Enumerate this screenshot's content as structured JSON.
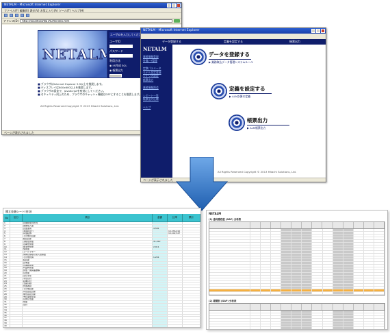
{
  "window1": {
    "title": "NETALM - Microsoft Internet Explorer",
    "menu": "ファイル(F)  編集(E)  表示(V)  お気に入り(A)  ツール(T)  ヘルプ(H)",
    "address_label": "アドレス(D)",
    "address_value": "http://localhost/NETALM/index.htm",
    "logo_text": "NETALM",
    "login": {
      "hint": "ユーザIDを入力してください",
      "user_label": "ユーザID",
      "password_label": "パスワード",
      "mode_label": "利用方法",
      "radio_1": "◉ IIS作成 SQL",
      "radio_2": "◉ 帳票出力"
    },
    "notes": [
      "ブラウザはInternet Explorer 5.5以上を推奨します。",
      "ディスプレイは800x600以上を推奨します。",
      "ブラウザの設定で、JavaScriptを有効にしてください。",
      "セキュリティ向上のため、ブラウザのキャッシュ機能はOFFにすることを推奨します。"
    ],
    "copyright": "All Rights Reserved Copyright © 2013 Hitachi Solutions, Ltd.",
    "status": "ページが表示されました"
  },
  "window2": {
    "title": "NETALM - Microsoft Internet Explorer",
    "topnav": [
      "データ登録する",
      "定義を設定する",
      "帳票出力"
    ],
    "logo_text": "NETALM",
    "sidenav": [
      "業務情報登録",
      "外貨ﾚｰﾄ管理",
      "定数パラメータ",
      "モデル設定登録",
      "シナリオ設定",
      "帳票出力",
      "業務情報照会",
      "レポート一覧",
      "帳票出力仕様",
      "ヘルプ"
    ],
    "steps": [
      {
        "title": "データを登録する",
        "sub": "▶ 業務取込データ管理システムルール"
      },
      {
        "title": "定義を設定する",
        "sub": "▶ ALM計算の定義"
      },
      {
        "title": "帳票出力",
        "sub": "▶ ALM帳票出力"
      }
    ],
    "copyright": "All Rights Reserved Copyright © 2013 Hitachi Solutions, Ltd.",
    "status": "ページが表示されました"
  },
  "sheet1": {
    "title": "積立金額シート(合計)",
    "headers": [
      "No",
      "区分",
      "項目",
      "金額",
      "比率",
      "累計"
    ],
    "rows": [
      [
        "1",
        "",
        "資金調達の状況",
        "",
        "",
        ""
      ],
      [
        "2",
        "",
        "長期借入金",
        "",
        "",
        ""
      ],
      [
        "3",
        "",
        "資金運用",
        "4,581",
        "",
        ""
      ],
      [
        "4",
        "",
        "運用利回り",
        "",
        "10,236,910",
        ""
      ],
      [
        "5",
        "",
        "有価証券",
        "",
        "10,102,547",
        ""
      ],
      [
        "6",
        "",
        "その他の資産",
        "",
        "",
        ""
      ],
      [
        "7",
        "",
        "繰延資産",
        "",
        "",
        ""
      ],
      [
        "8",
        "",
        "流動性預金",
        "31,012",
        "",
        ""
      ],
      [
        "9",
        "",
        "定期性預金",
        "",
        "",
        ""
      ],
      [
        "10",
        "",
        "譲渡性預金",
        "2,911",
        "",
        ""
      ],
      [
        "11",
        "",
        "借用金",
        "",
        "",
        ""
      ],
      [
        "12",
        "",
        "コールマネー",
        "",
        "",
        ""
      ],
      [
        "13",
        "",
        "債券貸借取引受入担保金",
        "",
        "",
        ""
      ],
      [
        "14",
        "",
        "その他負債",
        "1,241",
        "",
        ""
      ],
      [
        "15",
        "",
        "純資産",
        "",
        "",
        ""
      ],
      [
        "16",
        "",
        "資本金",
        "",
        "",
        ""
      ],
      [
        "17",
        "",
        "資本剰余金",
        "",
        "",
        ""
      ],
      [
        "18",
        "",
        "利益剰余金",
        "",
        "",
        ""
      ],
      [
        "19",
        "",
        "評価・換算差額等",
        "",
        "",
        ""
      ],
      [
        "20",
        "",
        "貸出金",
        "",
        "",
        ""
      ],
      [
        "21",
        "",
        "割引手形",
        "",
        "",
        ""
      ],
      [
        "22",
        "",
        "手形貸付",
        "",
        "",
        ""
      ],
      [
        "23",
        "",
        "証書貸付",
        "",
        "",
        ""
      ],
      [
        "24",
        "",
        "当座貸越",
        "",
        "",
        ""
      ],
      [
        "25",
        "",
        "外国為替",
        "",
        "",
        ""
      ],
      [
        "26",
        "",
        "その他資産",
        "",
        "",
        ""
      ],
      [
        "27",
        "",
        "有形固定資産",
        "",
        "",
        ""
      ],
      [
        "28",
        "",
        "無形固定資産",
        "",
        "",
        ""
      ],
      [
        "29",
        "",
        "支払承諾見返",
        "",
        "",
        ""
      ],
      [
        "30",
        "",
        "貸倒引当金",
        "",
        "",
        ""
      ],
      [
        "31",
        "",
        "預金",
        "",
        "",
        ""
      ],
      [
        "32",
        "",
        "合計",
        "",
        "",
        ""
      ],
      [
        "33",
        "",
        "",
        "",
        "",
        ""
      ],
      [
        "34",
        "",
        "",
        "",
        "",
        ""
      ],
      [
        "35",
        "",
        "",
        "",
        "",
        ""
      ],
      [
        "36",
        "",
        "",
        "",
        "",
        ""
      ],
      [
        "37",
        "",
        "",
        "",
        "",
        ""
      ],
      [
        "38",
        "",
        "",
        "",
        "",
        ""
      ],
      [
        "39",
        "",
        "",
        "",
        "",
        ""
      ],
      [
        "40",
        "",
        "",
        "",
        "",
        ""
      ]
    ]
  },
  "sheet2": {
    "title": "NETALM",
    "section1": "(1) 金利感応度 (GAP) 分析表",
    "section2": "(2) 期間別 (GAP) 分析表"
  },
  "colors": {
    "navy": "#0f1d6b",
    "sheet_header": "#3bc3cf",
    "highlight": "#f5b041",
    "arrow_blue": "#2f79c8"
  }
}
